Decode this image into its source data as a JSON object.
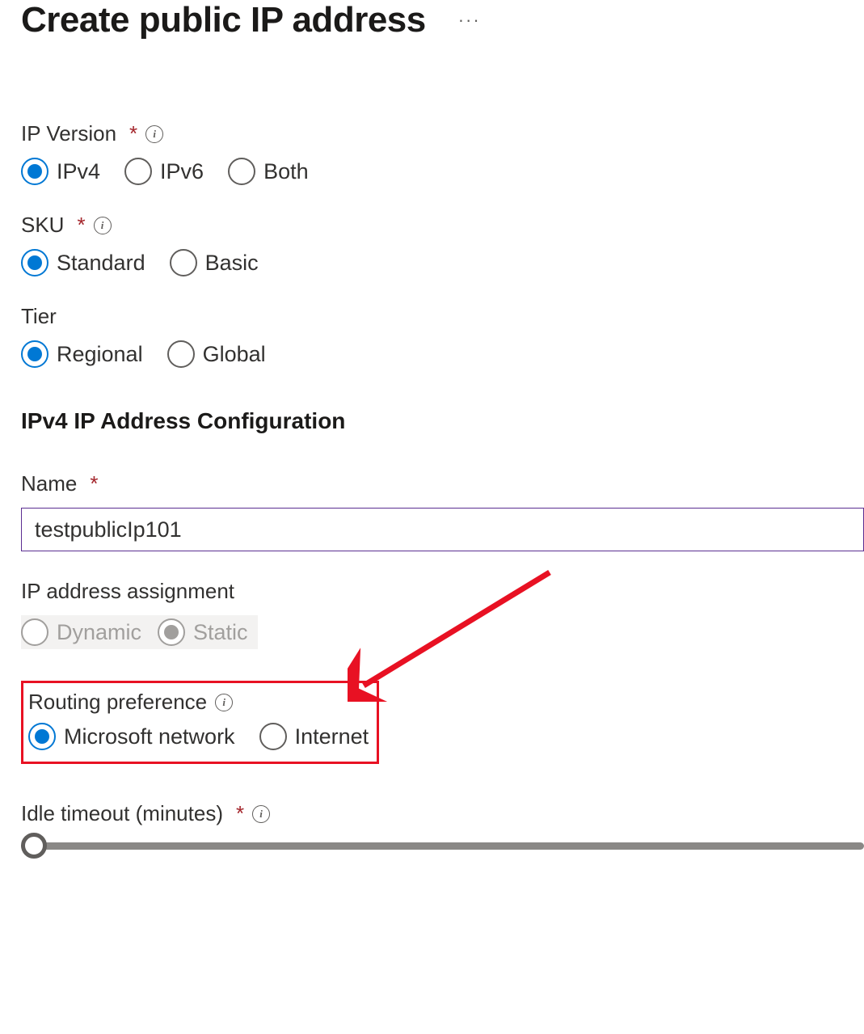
{
  "header": {
    "title": "Create public IP address"
  },
  "fields": {
    "ip_version": {
      "label": "IP Version",
      "options": {
        "ipv4": "IPv4",
        "ipv6": "IPv6",
        "both": "Both"
      }
    },
    "sku": {
      "label": "SKU",
      "options": {
        "standard": "Standard",
        "basic": "Basic"
      }
    },
    "tier": {
      "label": "Tier",
      "options": {
        "regional": "Regional",
        "global": "Global"
      }
    },
    "section_head": "IPv4 IP Address Configuration",
    "name": {
      "label": "Name",
      "value": "testpublicIp101"
    },
    "assignment": {
      "label": "IP address assignment",
      "options": {
        "dynamic": "Dynamic",
        "static": "Static"
      }
    },
    "routing": {
      "label": "Routing preference",
      "options": {
        "ms": "Microsoft network",
        "internet": "Internet"
      }
    },
    "idle": {
      "label": "Idle timeout (minutes)"
    }
  }
}
